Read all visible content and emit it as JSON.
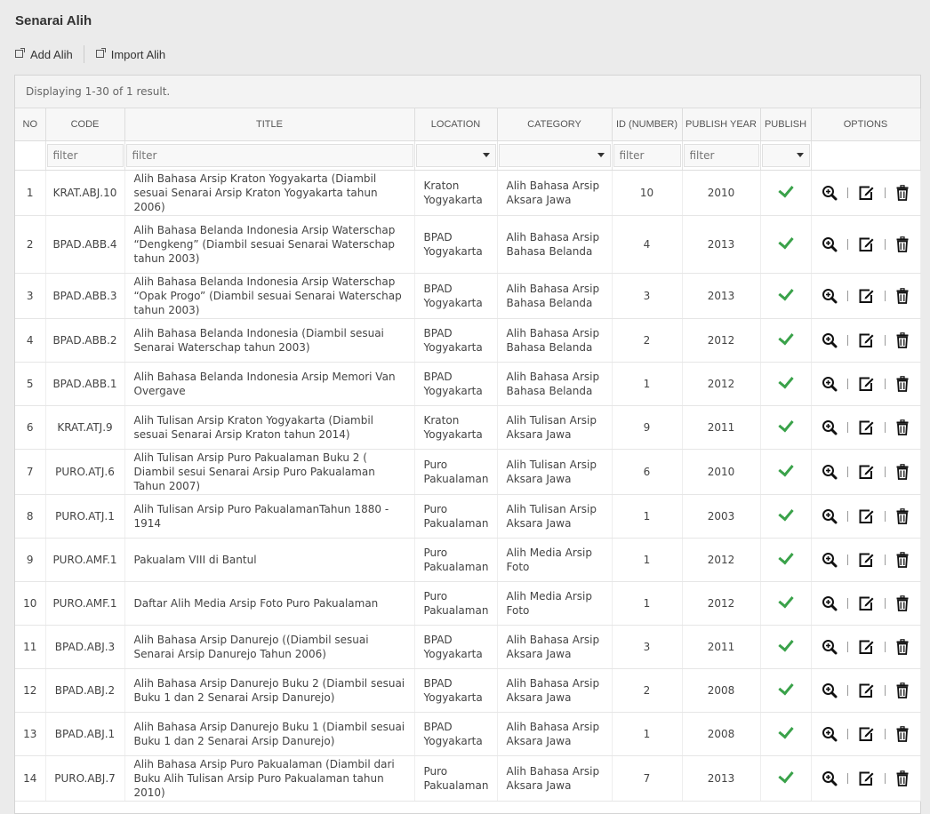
{
  "page_title": "Senarai Alih",
  "actions": {
    "add": "Add Alih",
    "import": "Import Alih"
  },
  "summary": "Displaying 1-30 of 1 result.",
  "columns": [
    "NO",
    "CODE",
    "TITLE",
    "LOCATION",
    "CATEGORY",
    "ID (NUMBER)",
    "PUBLISH YEAR",
    "PUBLISH",
    "OPTIONS"
  ],
  "filter_placeholder": "filter",
  "rows": [
    {
      "no": "1",
      "code": "KRAT.ABJ.10",
      "title": "Alih Bahasa Arsip Kraton Yogyakarta (Diambil sesuai Senarai Arsip Kraton Yogyakarta tahun 2006)",
      "location": "Kraton Yogyakarta",
      "category": "Alih Bahasa Arsip Aksara Jawa",
      "id": "10",
      "year": "2010"
    },
    {
      "no": "2",
      "code": "BPAD.ABB.4",
      "title": "Alih Bahasa Belanda Indonesia Arsip Waterschap “Dengkeng” (Diambil sesuai Senarai Waterschap tahun 2003)",
      "location": "BPAD Yogyakarta",
      "category": "Alih Bahasa Arsip Bahasa Belanda",
      "id": "4",
      "year": "2013"
    },
    {
      "no": "3",
      "code": "BPAD.ABB.3",
      "title": "Alih Bahasa Belanda Indonesia Arsip Waterschap “Opak Progo” (Diambil sesuai Senarai Waterschap tahun 2003)",
      "location": "BPAD Yogyakarta",
      "category": "Alih Bahasa Arsip Bahasa Belanda",
      "id": "3",
      "year": "2013"
    },
    {
      "no": "4",
      "code": "BPAD.ABB.2",
      "title": "Alih Bahasa Belanda Indonesia (Diambil sesuai Senarai Waterschap tahun 2003)",
      "location": "BPAD Yogyakarta",
      "category": "Alih Bahasa Arsip Bahasa Belanda",
      "id": "2",
      "year": "2012"
    },
    {
      "no": "5",
      "code": "BPAD.ABB.1",
      "title": "Alih Bahasa Belanda Indonesia Arsip Memori Van Overgave",
      "location": "BPAD Yogyakarta",
      "category": "Alih Bahasa Arsip Bahasa Belanda",
      "id": "1",
      "year": "2012"
    },
    {
      "no": "6",
      "code": "KRAT.ATJ.9",
      "title": "Alih Tulisan Arsip Kraton Yogyakarta (Diambil sesuai Senarai Arsip Kraton tahun 2014)",
      "location": "Kraton Yogyakarta",
      "category": "Alih Tulisan Arsip Aksara Jawa",
      "id": "9",
      "year": "2011"
    },
    {
      "no": "7",
      "code": "PURO.ATJ.6",
      "title": "Alih Tulisan Arsip Puro Pakualaman Buku 2 ( Diambil sesui Senarai Arsip Puro Pakualaman Tahun 2007)",
      "location": "Puro Pakualaman",
      "category": "Alih Tulisan Arsip Aksara Jawa",
      "id": "6",
      "year": "2010"
    },
    {
      "no": "8",
      "code": "PURO.ATJ.1",
      "title": "Alih Tulisan Arsip Puro PakualamanTahun 1880 - 1914",
      "location": "Puro Pakualaman",
      "category": "Alih Tulisan Arsip Aksara Jawa",
      "id": "1",
      "year": "2003"
    },
    {
      "no": "9",
      "code": "PURO.AMF.1",
      "title": "Pakualam VIII di Bantul",
      "location": "Puro Pakualaman",
      "category": "Alih Media Arsip Foto",
      "id": "1",
      "year": "2012"
    },
    {
      "no": "10",
      "code": "PURO.AMF.1",
      "title": "Daftar Alih Media Arsip Foto Puro Pakualaman",
      "location": "Puro Pakualaman",
      "category": "Alih Media Arsip Foto",
      "id": "1",
      "year": "2012"
    },
    {
      "no": "11",
      "code": "BPAD.ABJ.3",
      "title": "Alih Bahasa Arsip Danurejo ((Diambil sesuai Senarai Arsip Danurejo Tahun 2006)",
      "location": "BPAD Yogyakarta",
      "category": "Alih Bahasa Arsip Aksara Jawa",
      "id": "3",
      "year": "2011"
    },
    {
      "no": "12",
      "code": "BPAD.ABJ.2",
      "title": "Alih Bahasa Arsip Danurejo Buku 2 (Diambil sesuai Buku 1 dan 2 Senarai Arsip Danurejo)",
      "location": "BPAD Yogyakarta",
      "category": "Alih Bahasa Arsip Aksara Jawa",
      "id": "2",
      "year": "2008"
    },
    {
      "no": "13",
      "code": "BPAD.ABJ.1",
      "title": "Alih Bahasa Arsip Danurejo Buku 1 (Diambil sesuai Buku 1 dan 2 Senarai Arsip Danurejo)",
      "location": "BPAD Yogyakarta",
      "category": "Alih Bahasa Arsip Aksara Jawa",
      "id": "1",
      "year": "2008"
    },
    {
      "no": "14",
      "code": "PURO.ABJ.7",
      "title": "Alih Bahasa Arsip Puro Pakualaman (Diambil dari Buku Alih Tulisan Arsip Puro Pakualaman tahun 2010)",
      "location": "Puro Pakualaman",
      "category": "Alih Bahasa Arsip Aksara Jawa",
      "id": "7",
      "year": "2013"
    }
  ],
  "colors": {
    "check": "#3aa24a"
  }
}
